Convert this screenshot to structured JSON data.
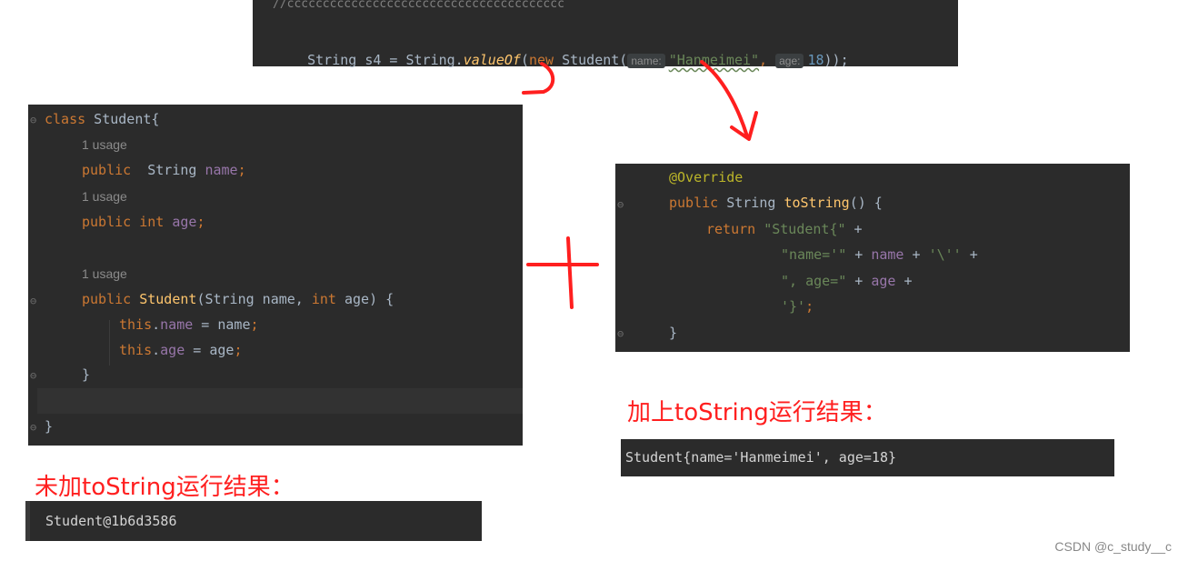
{
  "top_snippet": {
    "partial_line": "//ccccccccccccccccccccccccccccccccccccccc",
    "code": {
      "p1": "String s4 = String.",
      "method": "valueOf",
      "p2": "(",
      "kw_new": "new",
      "p3": " Student(",
      "hint_name": "name:",
      "str_val": "\"Hanmeimei\"",
      "comma": ",",
      "hint_age": "age:",
      "num_val": "18",
      "p4": "));"
    }
  },
  "left_panel": {
    "line1": {
      "kw": "class",
      "rest": " Student{"
    },
    "usage1": "1 usage",
    "line2": {
      "kw": "public",
      "type": "  String ",
      "field": "name",
      "end": ";"
    },
    "usage2": "1 usage",
    "line3": {
      "kw": "public",
      "type": " int ",
      "field": "age",
      "end": ";"
    },
    "usage3": "1 usage",
    "line4": {
      "kw": "public",
      "ctor": " Student",
      "p1": "(String name, ",
      "kw2": "int",
      "p2": " age) {"
    },
    "line5": {
      "kw": "this",
      "dot": ".",
      "field": "name",
      "rest": " = name",
      "end": ";"
    },
    "line6": {
      "kw": "this",
      "dot": ".",
      "field": "age",
      "rest": " = age",
      "end": ";"
    },
    "line7": "}",
    "line8": "}"
  },
  "right_panel": {
    "annotation": "@Override",
    "sig": {
      "kw": "public",
      "type": " String ",
      "fn": "toString",
      "rest": "() {"
    },
    "ret": {
      "kw": "return",
      "str": " \"Student{\"",
      "rest": " +"
    },
    "l4": {
      "str": "\"name='\"",
      "p1": " + ",
      "field": "name",
      "p2": " + ",
      "str2": "'\\''",
      "p3": " +"
    },
    "l5": {
      "str": "\", age=\"",
      "p1": " + ",
      "field": "age",
      "p2": " +"
    },
    "l6": {
      "str": "'}'",
      "end": ";"
    },
    "close": "}"
  },
  "plus_sign": "+",
  "caption_with": "加上toString运行结果：",
  "caption_without": "未加toString运行结果：",
  "output_with": "Student{name='Hanmeimei', age=18}",
  "output_without": "Student@1b6d3586",
  "watermark": "CSDN @c_study__c",
  "colors": {
    "annotation_red": "#ff1f1f",
    "editor_bg": "#2b2b2b"
  }
}
